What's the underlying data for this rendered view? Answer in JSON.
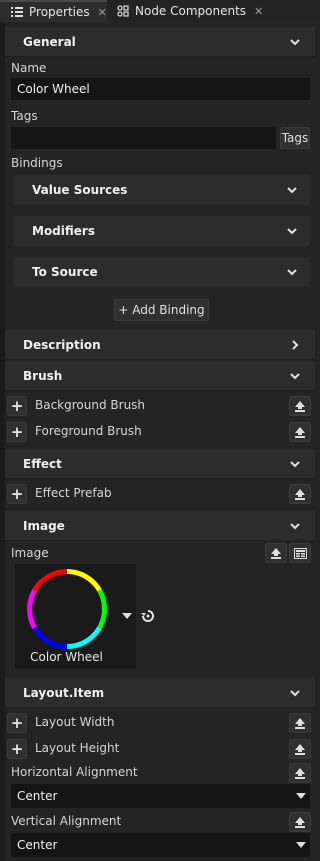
{
  "tabs": [
    {
      "label": "Properties",
      "icon": "list-icon"
    },
    {
      "label": "Node Components",
      "icon": "components-icon"
    }
  ],
  "sections": {
    "general": "General",
    "description": "Description",
    "brush": "Brush",
    "effect": "Effect",
    "image": "Image",
    "layout": "Layout.Item"
  },
  "general": {
    "name_label": "Name",
    "name_value": "Color Wheel",
    "tags_label": "Tags",
    "tags_value": "",
    "tags_button": "Tags",
    "bindings_label": "Bindings",
    "binding_groups": [
      "Value Sources",
      "Modifiers",
      "To Source"
    ],
    "add_binding": "+ Add Binding"
  },
  "brush": {
    "items": [
      "Background Brush",
      "Foreground Brush"
    ]
  },
  "effect": {
    "items": [
      "Effect Prefab"
    ]
  },
  "image": {
    "label": "Image",
    "asset_name": "Color Wheel"
  },
  "layout": {
    "items": [
      "Layout Width",
      "Layout Height"
    ],
    "horizontal_label": "Horizontal Alignment",
    "horizontal_value": "Center",
    "vertical_label": "Vertical Alignment",
    "vertical_value": "Center"
  },
  "colors": {
    "background": "#242424",
    "header": "#2c2c2c",
    "input": "#141414",
    "text": "#d6d6d6"
  }
}
